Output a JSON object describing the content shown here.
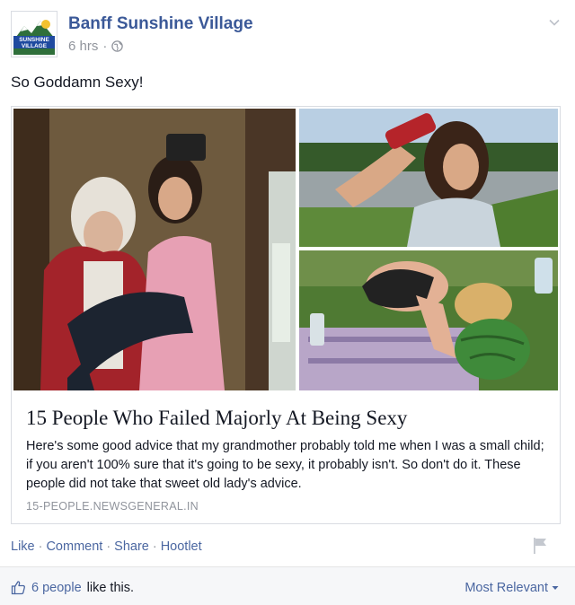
{
  "post": {
    "page_name": "Banff Sunshine Village",
    "logo_text_top": "SUNSHINE",
    "logo_text_bottom": "VILLAGE",
    "time": "6 hrs",
    "separator": "·",
    "audience_icon": "globe-icon",
    "text": "So Goddamn Sexy!"
  },
  "attachment": {
    "title": "15 People Who Failed Majorly At Being Sexy",
    "description": "Here's some good advice that my grandmother probably told me when I was a small child; if you aren't 100% sure that it's going to be sexy, it probably isn't. So don't do it. These people did not take that sweet old lady's advice.",
    "domain": "15-PEOPLE.NEWSGENERAL.IN"
  },
  "actions": {
    "like": "Like",
    "comment": "Comment",
    "share": "Share",
    "hootlet": "Hootlet",
    "separator": "·"
  },
  "footer": {
    "likes_count": "6 people",
    "likes_suffix": "like this.",
    "sort_label": "Most Relevant"
  },
  "colors": {
    "link_blue": "#3b5998",
    "action_blue": "#4b67a1",
    "meta_gray": "#90949c",
    "text": "#141823",
    "footer_bg": "#f6f7f9"
  }
}
